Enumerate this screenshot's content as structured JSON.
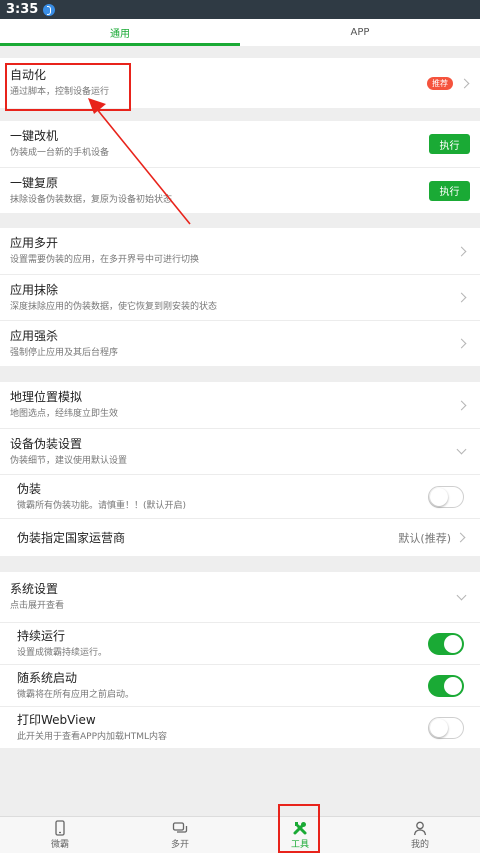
{
  "status_bar": {
    "time": "3:35"
  },
  "tabs": [
    {
      "label": "通用"
    },
    {
      "label": "APP"
    }
  ],
  "automation": {
    "title": "自动化",
    "sub": "通过脚本，控制设备运行",
    "badge": "推荐"
  },
  "one_key": {
    "change": {
      "title": "一键改机",
      "sub": "伪装成一台新的手机设备",
      "button": "执行"
    },
    "restore": {
      "title": "一键复原",
      "sub": "抹除设备伪装数据，复原为设备初始状态",
      "button": "执行"
    }
  },
  "apps": {
    "multi": {
      "title": "应用多开",
      "sub": "设置需要伪装的应用，在多开界号中可进行切换"
    },
    "erase": {
      "title": "应用抹除",
      "sub": "深度抹除应用的伪装数据，使它恢复到刚安装的状态"
    },
    "kill": {
      "title": "应用强杀",
      "sub": "强制停止应用及其后台程序"
    }
  },
  "location": {
    "title": "地理位置模拟",
    "sub": "地图选点，经纬度立即生效"
  },
  "device_disguise": {
    "title": "设备伪装设置",
    "sub": "伪装细节，建议使用默认设置",
    "disguise": {
      "title": "伪装",
      "sub": "微霸所有伪装功能。请慎重！！(默认开启)",
      "on": false
    },
    "carrier": {
      "title": "伪装指定国家运营商",
      "value": "默认(推荐)"
    }
  },
  "system": {
    "title": "系统设置",
    "sub": "点击展开查看",
    "keep_running": {
      "title": "持续运行",
      "sub": "设置成微霸持续运行。",
      "on": true
    },
    "autostart": {
      "title": "随系统启动",
      "sub": "微霸将在所有应用之前启动。",
      "on": true
    },
    "webview": {
      "title": "打印WebView",
      "sub": "此开关用于查看APP内加载HTML内容",
      "on": false
    }
  },
  "bottom_nav": [
    {
      "label": "微霸",
      "icon": "phone-icon"
    },
    {
      "label": "多开",
      "icon": "chat-icon"
    },
    {
      "label": "工具",
      "icon": "tools-icon"
    },
    {
      "label": "我的",
      "icon": "person-icon"
    }
  ],
  "colors": {
    "accent": "#1aaa35",
    "badge": "#f5533d",
    "annotation": "#e8231b",
    "status_bar": "#2f3a44"
  }
}
